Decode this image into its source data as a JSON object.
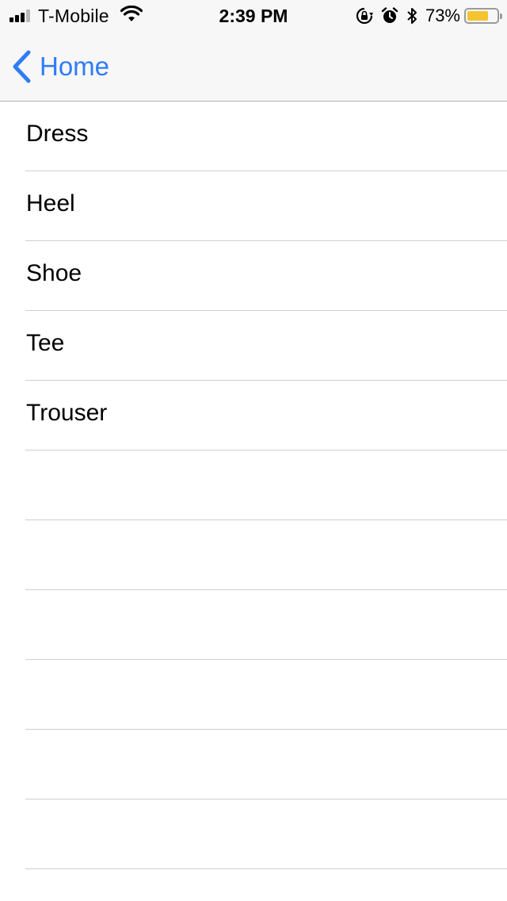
{
  "status_bar": {
    "carrier": "T-Mobile",
    "time": "2:39 PM",
    "battery_percent": "73%",
    "battery_level": 0.73,
    "battery_color": "#f4c430",
    "icons": [
      "signal-icon",
      "wifi-icon",
      "orientation-lock-icon",
      "alarm-icon",
      "bluetooth-icon",
      "battery-icon"
    ]
  },
  "nav": {
    "back_label": "Home",
    "accent_color": "#2f7cf6",
    "back_icon": "chevron-left-icon"
  },
  "table": {
    "items": [
      {
        "label": "Dress"
      },
      {
        "label": "Heel"
      },
      {
        "label": "Shoe"
      },
      {
        "label": "Tee"
      },
      {
        "label": "Trouser"
      },
      {
        "label": ""
      },
      {
        "label": ""
      },
      {
        "label": ""
      },
      {
        "label": ""
      },
      {
        "label": ""
      },
      {
        "label": ""
      }
    ]
  }
}
